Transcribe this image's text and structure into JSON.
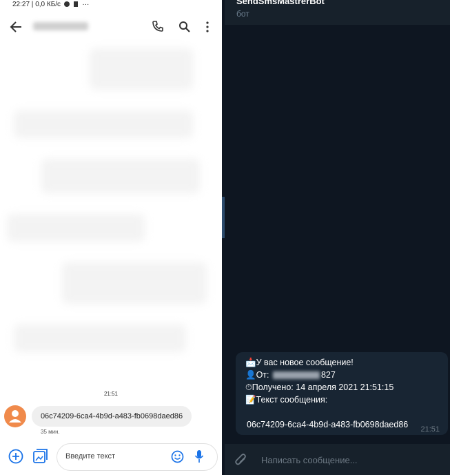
{
  "phone": {
    "status_time": "22:27",
    "status_speed": "0,0 КБ/с",
    "status_dots": "···",
    "battery": "99",
    "timestamp": "21:51",
    "message_text": "06c74209-6ca4-4b9d-a483-fb0698daed86",
    "message_age": "35 мин.",
    "input_placeholder": "Введите текст"
  },
  "telegram": {
    "chat_title": "SendSmsMastrerBot",
    "chat_subtitle": "бот",
    "message": {
      "line1": "У вас новое сообщение!",
      "line2_prefix": "От: ",
      "line2_suffix": "827",
      "line3": "Получено: 14 апреля 2021 21:51:15",
      "line4": "Текст сообщения:",
      "line5": "06c74209-6ca4-4b9d-a483-fb0698daed86",
      "time": "21:51"
    },
    "input_placeholder": "Написать сообщение..."
  }
}
